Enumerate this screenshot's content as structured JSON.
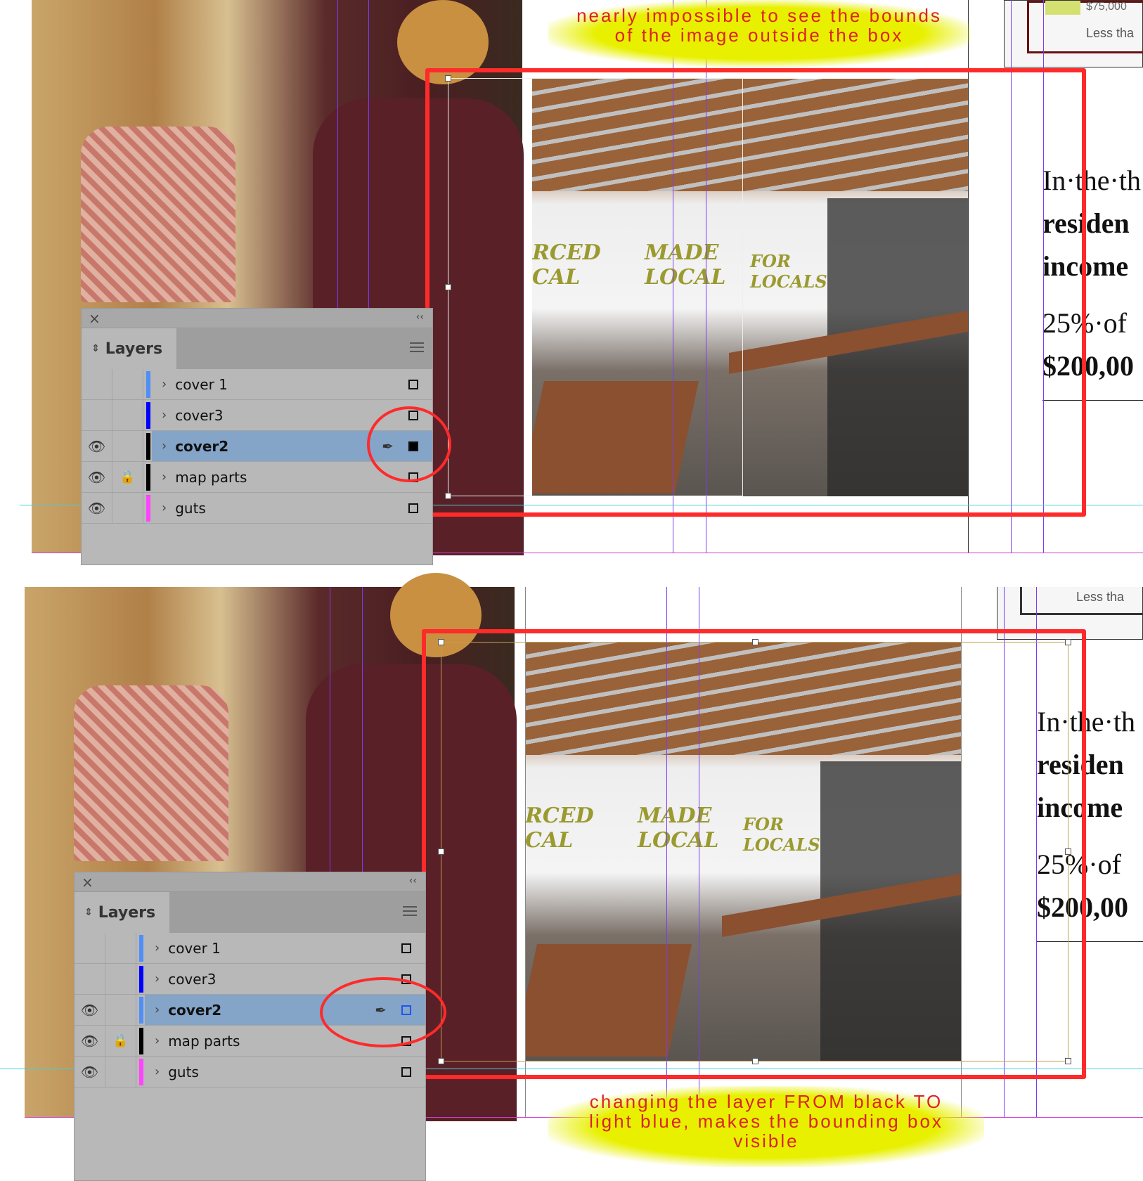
{
  "annotations": {
    "top": "nearly impossible to see the bounds of the image outside the box",
    "bottom": "changing the layer FROM black TO light blue, makes the bounding box visible"
  },
  "cafe_sign": {
    "left": "RCED CAL",
    "middle": "MADE LOCAL",
    "right": "FOR LOCALS"
  },
  "text_column": {
    "line1": "In·the·th",
    "line2": "residen",
    "line3": "income",
    "line4": "25%·of",
    "line5": "$200,00"
  },
  "map_legend": {
    "item1": "$75,000",
    "item2": "Less tha"
  },
  "layers_panel": {
    "title": "Layers",
    "layers": [
      {
        "name": "cover 1",
        "color": "#4f8ff7",
        "visible": false,
        "locked": false
      },
      {
        "name": "cover3",
        "color": "#0000ff",
        "visible": false,
        "locked": false
      },
      {
        "name": "cover2",
        "color_top": "#000000",
        "color_bottom": "#4f8ff7",
        "visible": true,
        "locked": false,
        "selected": true
      },
      {
        "name": "map parts",
        "color": "#000000",
        "visible": true,
        "locked": true
      },
      {
        "name": "guts",
        "color": "#ff44ff",
        "visible": true,
        "locked": false
      }
    ]
  },
  "colors": {
    "annotation_red": "#ff2a2a",
    "highlight": "#e8f000",
    "selection": "#84a4c8"
  }
}
